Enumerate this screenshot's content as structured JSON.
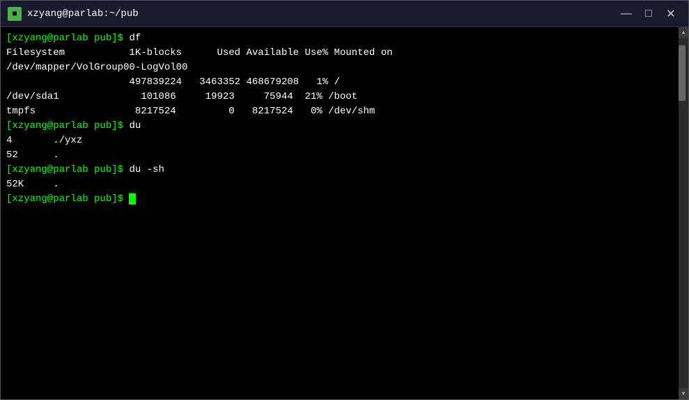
{
  "titlebar": {
    "title": "xzyang@parlab:~/pub",
    "icon": "■",
    "minimize_label": "—",
    "maximize_label": "□",
    "close_label": "✕"
  },
  "terminal": {
    "lines": [
      {
        "type": "prompt",
        "text": "[xzyang@parlab pub]$ df"
      },
      {
        "type": "output",
        "text": "Filesystem           1K-blocks      Used Available Use% Mounted on"
      },
      {
        "type": "output",
        "text": "/dev/mapper/VolGroup00-LogVol00"
      },
      {
        "type": "output",
        "text": "                     497839224   3463352 468679208   1% /"
      },
      {
        "type": "output",
        "text": "/dev/sda1              101086     19923     75944  21% /boot"
      },
      {
        "type": "output",
        "text": "tmpfs                 8217524         0   8217524   0% /dev/shm"
      },
      {
        "type": "prompt",
        "text": "[xzyang@parlab pub]$ du"
      },
      {
        "type": "output",
        "text": "4\t./yxz"
      },
      {
        "type": "output",
        "text": "52\t."
      },
      {
        "type": "prompt",
        "text": "[xzyang@parlab pub]$ du -sh"
      },
      {
        "type": "output",
        "text": "52K\t."
      },
      {
        "type": "prompt_cursor",
        "text": "[xzyang@parlab pub]$ "
      }
    ]
  },
  "scrollbar": {
    "up_arrow": "▲",
    "down_arrow": "▼"
  }
}
